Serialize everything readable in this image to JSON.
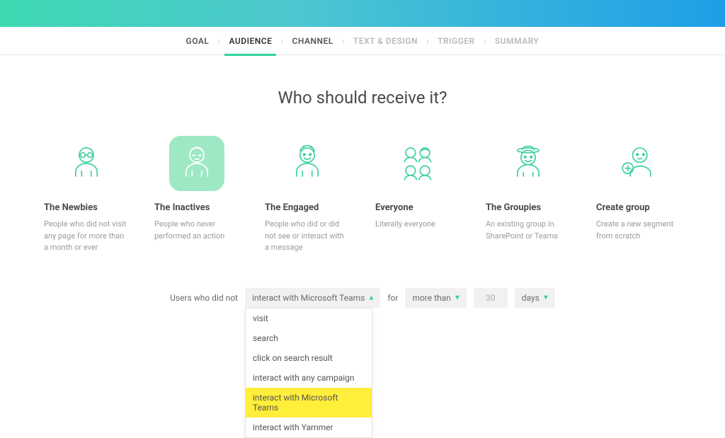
{
  "stepper": {
    "steps": [
      {
        "label": "GOAL",
        "state": "completed"
      },
      {
        "label": "AUDIENCE",
        "state": "active"
      },
      {
        "label": "CHANNEL",
        "state": "completed"
      },
      {
        "label": "TEXT & DESIGN",
        "state": "upcoming"
      },
      {
        "label": "TRIGGER",
        "state": "upcoming"
      },
      {
        "label": "SUMMARY",
        "state": "upcoming"
      }
    ]
  },
  "page_title": "Who should receive it?",
  "audience_cards": [
    {
      "key": "newbies",
      "title": "The Newbies",
      "desc": "People who did not visit any page for more than a month or ever",
      "selected": false
    },
    {
      "key": "inactives",
      "title": "The Inactives",
      "desc": "People who never performed an action",
      "selected": true
    },
    {
      "key": "engaged",
      "title": "The Engaged",
      "desc": "People who did or did not see or interact with a message",
      "selected": false
    },
    {
      "key": "everyone",
      "title": "Everyone",
      "desc": "Literally everyone",
      "selected": false
    },
    {
      "key": "groupies",
      "title": "The Groupies",
      "desc": "An existing group in SharePoint or Teams",
      "selected": false
    },
    {
      "key": "create",
      "title": "Create group",
      "desc": "Create a new segment from scratch",
      "selected": false
    }
  ],
  "rule": {
    "prefix": "Users who did not",
    "action_selected": "interact with Microsoft Teams",
    "action_options": [
      {
        "label": "visit",
        "highlight": false
      },
      {
        "label": "search",
        "highlight": false
      },
      {
        "label": "click on search result",
        "highlight": false
      },
      {
        "label": "interact with any campaign",
        "highlight": false
      },
      {
        "label": "interact with Microsoft Teams",
        "highlight": true
      },
      {
        "label": "interact with Yammer",
        "highlight": false
      }
    ],
    "for_label": "for",
    "comparator": "more than",
    "value": "30",
    "unit": "days"
  }
}
